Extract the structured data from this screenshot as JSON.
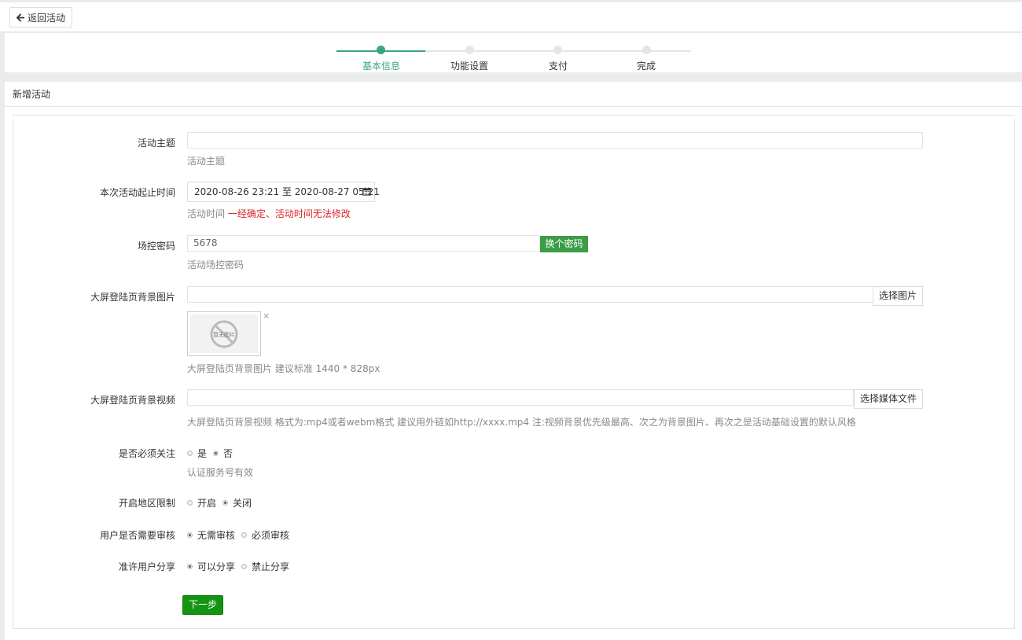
{
  "topbar": {
    "back_label": "返回活动"
  },
  "steps": [
    {
      "label": "基本信息",
      "active": true
    },
    {
      "label": "功能设置",
      "active": false
    },
    {
      "label": "支付",
      "active": false
    },
    {
      "label": "完成",
      "active": false
    }
  ],
  "panel": {
    "title": "新增活动"
  },
  "form": {
    "theme": {
      "label": "活动主题",
      "value": "",
      "help": "活动主题"
    },
    "time": {
      "label": "本次活动起止时间",
      "value": "2020-08-26 23:21 至 2020-08-27 05:21",
      "help": "活动时间",
      "warning": "一经确定、活动时间无法修改"
    },
    "password": {
      "label": "场控密码",
      "value": "5678",
      "button": "换个密码",
      "help": "活动场控密码"
    },
    "bg_image": {
      "label": "大屏登陆页背景图片",
      "value": "",
      "button": "选择图片",
      "thumb_text": "暂无图片",
      "close": "×",
      "help": "大屏登陆页背景图片 建议标准 1440 * 828px"
    },
    "bg_video": {
      "label": "大屏登陆页背景视频",
      "value": "",
      "button": "选择媒体文件",
      "help": "大屏登陆页背景视频 格式为:mp4或者webm格式 建议用外链如http://xxxx.mp4 注:视频背景优先级最高、次之为背景图片、再次之是活动基础设置的默认风格"
    },
    "must_follow": {
      "label": "是否必须关注",
      "options": [
        "是",
        "否"
      ],
      "selected": 1,
      "help": "认证服务号有效"
    },
    "region_limit": {
      "label": "开启地区限制",
      "options": [
        "开启",
        "关闭"
      ],
      "selected": 1
    },
    "audit": {
      "label": "用户是否需要审核",
      "options": [
        "无需审核",
        "必须审核"
      ],
      "selected": 0
    },
    "share": {
      "label": "准许用户分享",
      "options": [
        "可以分享",
        "禁止分享"
      ],
      "selected": 0
    },
    "next_button": "下一步"
  },
  "colors": {
    "accent": "#3aa57b",
    "primary_button": "#139413",
    "warning": "#d9262b"
  }
}
